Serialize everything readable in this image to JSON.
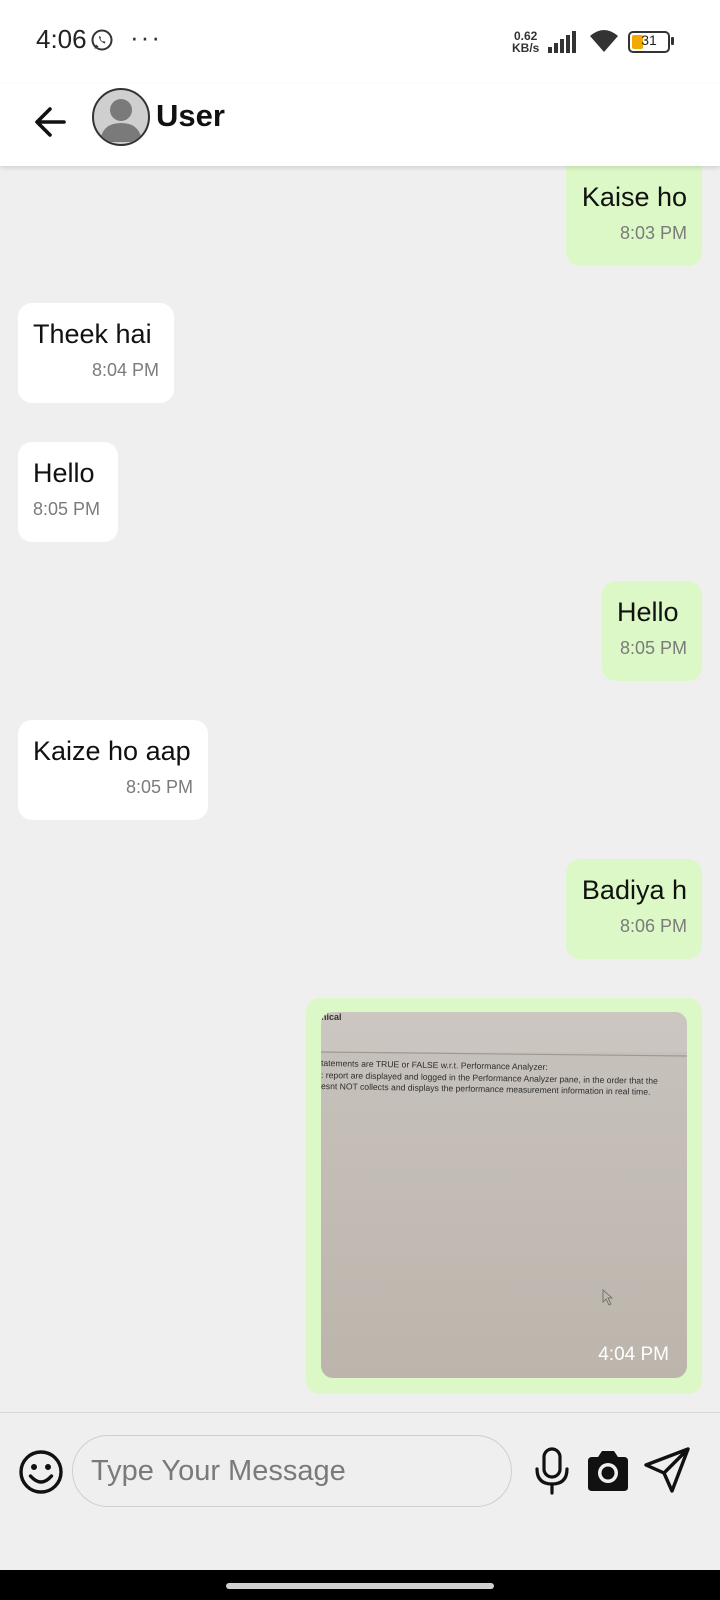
{
  "status_bar": {
    "time": "4:06",
    "more": "···",
    "net_speed_value": "0.62",
    "net_speed_unit": "KB/s",
    "battery_level": "31",
    "battery_color": "#f2a900"
  },
  "header": {
    "contact_name": "User",
    "back_icon": "arrow-left-icon",
    "avatar_icon": "person-icon"
  },
  "messages": [
    {
      "direction": "out",
      "text": "Kaise ho",
      "time": "8:03 PM"
    },
    {
      "direction": "in",
      "text": "Theek hai",
      "time": "8:04 PM"
    },
    {
      "direction": "in",
      "text": "Hello",
      "time": "8:05 PM"
    },
    {
      "direction": "out",
      "text": "Hello",
      "time": "8:05 PM"
    },
    {
      "direction": "in",
      "text": "Kaize ho aap",
      "time": "8:05 PM"
    },
    {
      "direction": "out",
      "text": "Badiya h",
      "time": "8:06 PM"
    }
  ],
  "image_message": {
    "direction": "out",
    "time": "4:04 PM",
    "photo_text": {
      "heading": "nical",
      "line1": "tatements are TRUE or FALSE w.r.t. Performance Analyzer:",
      "line2": ": report are displayed and logged in the Performance Analyzer pane, in the order that the",
      "line3": "esnt NOT collects and displays the performance measurement information in real time."
    }
  },
  "composer": {
    "placeholder": "Type Your Message",
    "value": ""
  },
  "colors": {
    "incoming_bubble": "#ffffff",
    "outgoing_bubble": "#dcf8c6",
    "chat_background": "#efefef"
  }
}
